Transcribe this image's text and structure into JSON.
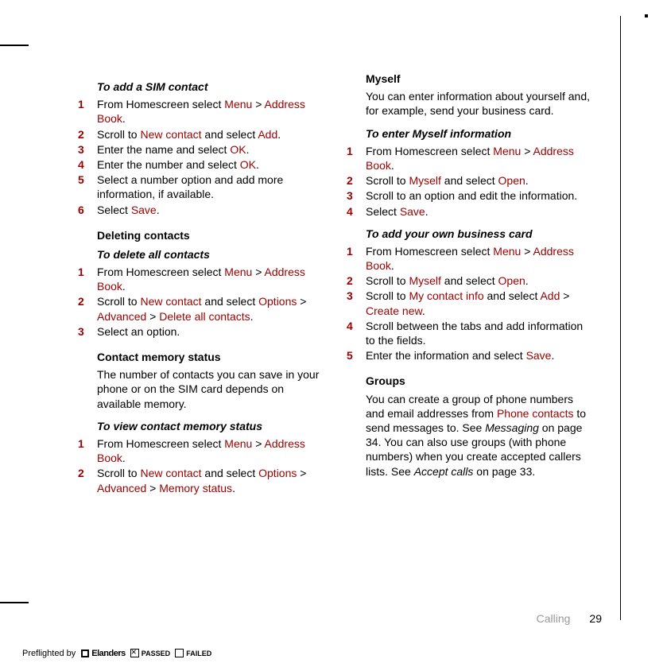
{
  "left": {
    "h1": "To add a SIM contact",
    "s1": [
      {
        "n": "1",
        "pre": "From Homescreen select ",
        "m1": "Menu",
        "mid": " > ",
        "m2": "Address Book",
        "post": "."
      },
      {
        "n": "2",
        "pre": "Scroll to ",
        "m1": "New contact",
        "mid": " and select ",
        "m2": "Add",
        "post": "."
      },
      {
        "n": "3",
        "pre": "Enter the name and select ",
        "m1": "OK",
        "post": "."
      },
      {
        "n": "4",
        "pre": "Enter the number and select ",
        "m1": "OK",
        "post": "."
      },
      {
        "n": "5",
        "pre": "Select a number option and add more information, if available.",
        "post": ""
      },
      {
        "n": "6",
        "pre": "Select ",
        "m1": "Save",
        "post": "."
      }
    ],
    "h2": "Deleting contacts",
    "h3": "To delete all contacts",
    "s2": [
      {
        "n": "1",
        "pre": "From Homescreen select ",
        "m1": "Menu",
        "mid": " > ",
        "m2": "Address Book",
        "post": "."
      },
      {
        "n": "2",
        "pre": "Scroll to ",
        "m1": "New contact",
        "mid": " and select ",
        "m2": "Options",
        "mid2": " > ",
        "m3": "Advanced",
        "mid3": " > ",
        "m4": "Delete all contacts",
        "post": "."
      },
      {
        "n": "3",
        "pre": "Select an option.",
        "post": ""
      }
    ],
    "h4": "Contact memory status",
    "p1": "The number of contacts you can save in your phone or on the SIM card depends on available memory.",
    "h5": "To view contact memory status",
    "s3": [
      {
        "n": "1",
        "pre": "From Homescreen select ",
        "m1": "Menu",
        "mid": " > ",
        "m2": "Address Book",
        "post": "."
      },
      {
        "n": "2",
        "pre": "Scroll to ",
        "m1": "New contact",
        "mid": " and select ",
        "m2": "Options",
        "mid2": " > ",
        "m3": "Advanced",
        "mid3": " > ",
        "m4": "Memory status",
        "post": "."
      }
    ]
  },
  "right": {
    "h1": "Myself",
    "p1": "You can enter information about yourself and, for example, send your business card.",
    "h2": "To enter Myself information",
    "s1": [
      {
        "n": "1",
        "pre": "From Homescreen select ",
        "m1": "Menu",
        "mid": " > ",
        "m2": "Address Book",
        "post": "."
      },
      {
        "n": "2",
        "pre": "Scroll to ",
        "m1": "Myself",
        "mid": " and select ",
        "m2": "Open",
        "post": "."
      },
      {
        "n": "3",
        "pre": "Scroll to an option and edit the information.",
        "post": ""
      },
      {
        "n": "4",
        "pre": "Select ",
        "m1": "Save",
        "post": "."
      }
    ],
    "h3": "To add your own business card",
    "s2": [
      {
        "n": "1",
        "pre": "From Homescreen select ",
        "m1": "Menu",
        "mid": " > ",
        "m2": "Address Book",
        "post": "."
      },
      {
        "n": "2",
        "pre": "Scroll to ",
        "m1": "Myself",
        "mid": " and select ",
        "m2": "Open",
        "post": "."
      },
      {
        "n": "3",
        "pre": "Scroll to ",
        "m1": "My contact info",
        "mid": " and select ",
        "m2": "Add",
        "mid2": " > ",
        "m3": "Create new",
        "post": "."
      },
      {
        "n": "4",
        "pre": "Scroll between the tabs and add information to the fields.",
        "post": ""
      },
      {
        "n": "5",
        "pre": "Enter the information and select ",
        "m1": "Save",
        "post": "."
      }
    ],
    "h4": "Groups",
    "p2a": "You can create a group of phone numbers and email addresses from ",
    "p2m": "Phone contacts",
    "p2b": " to send messages to. See ",
    "p2i1": "Messaging",
    "p2c": " on page 34. You can also use groups (with phone numbers) when you create accepted callers lists. See ",
    "p2i2": "Accept calls",
    "p2d": " on page 33."
  },
  "footer": {
    "section": "Calling",
    "page": "29"
  },
  "preflight": {
    "label": "Preflighted by",
    "brand": "Elanders",
    "passed": "PASSED",
    "failed": "FAILED"
  }
}
